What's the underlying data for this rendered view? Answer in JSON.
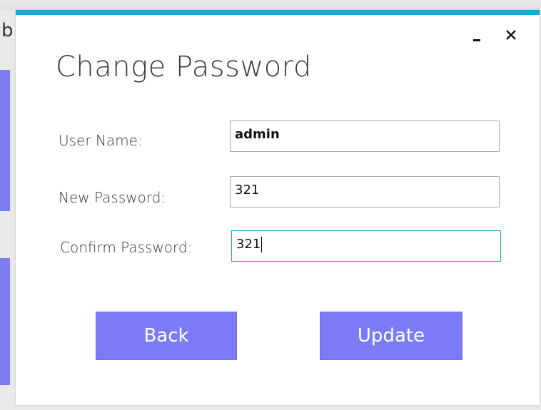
{
  "background": {
    "partial_text": "b"
  },
  "dialog": {
    "title": "Change Password",
    "controls": {
      "minimize_label": "-",
      "close_label": "✕"
    },
    "fields": [
      {
        "label": "User Name:",
        "value": "admin"
      },
      {
        "label": "New Password:",
        "value": "321"
      },
      {
        "label": "Confirm Password:",
        "value": "321"
      }
    ],
    "buttons": {
      "back_label": "Back",
      "update_label": "Update"
    }
  },
  "colors": {
    "accent_top_bar": "#19a9d8",
    "button_bg": "#7b7bf8",
    "focus_border": "#1ea2d8"
  }
}
